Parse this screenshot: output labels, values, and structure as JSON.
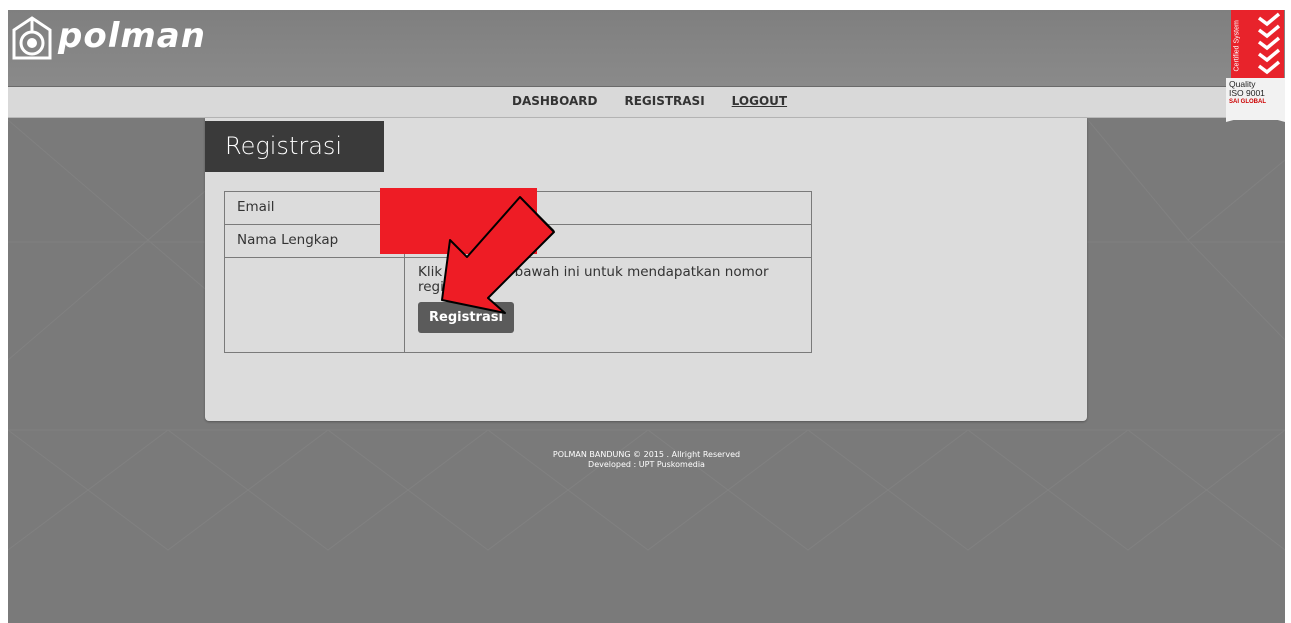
{
  "header": {
    "logo_text": "polman"
  },
  "nav": {
    "items": [
      "DASHBOARD",
      "REGISTRASI",
      "LOGOUT"
    ]
  },
  "panel": {
    "title": "Registrasi",
    "form": {
      "email_label": "Email",
      "name_label": "Nama Lengkap",
      "info_text": "Klik tombol di bawah ini untuk mendapatkan nomor registrasi",
      "button_label": "Registrasi"
    }
  },
  "footer": {
    "line1": "POLMAN BANDUNG © 2015 . Allright Reserved",
    "line2": "Developed : UPT Puskomedia"
  },
  "iso_badge": {
    "vertical_text": "Certified System",
    "line1": "Quality",
    "line2": "ISO 9001",
    "line3": "SAI GLOBAL"
  },
  "colors": {
    "redaction": "#ee1c25",
    "arrow": "#ee1c25",
    "title_bar": "#3a3a3a",
    "button": "#5b5b5b"
  }
}
